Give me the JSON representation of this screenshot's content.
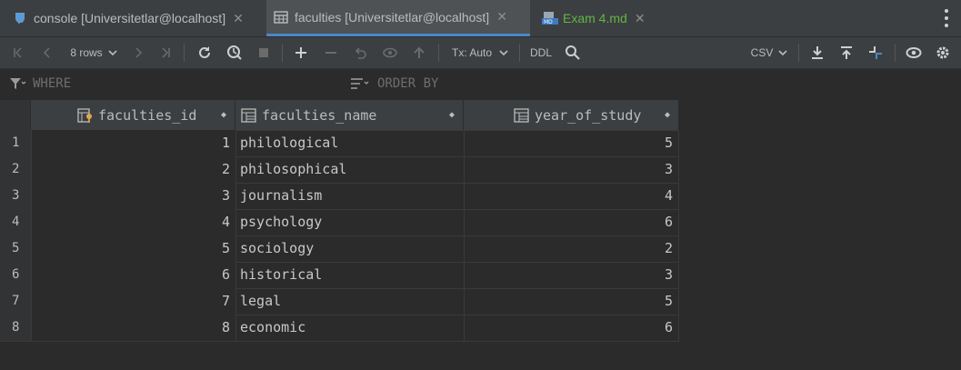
{
  "tabs": [
    {
      "label": "console [Universitetlar@localhost]",
      "icon": "database-console-icon"
    },
    {
      "label": "faculties [Universitetlar@localhost]",
      "icon": "table-icon"
    },
    {
      "label": "Exam 4.md",
      "icon": "markdown-file-icon"
    }
  ],
  "toolbar": {
    "rows_label": "8 rows",
    "tx_label": "Tx: Auto",
    "ddl_label": "DDL",
    "csv_label": "CSV"
  },
  "filter": {
    "where_label": "WHERE",
    "order_label": "ORDER BY"
  },
  "columns": [
    "faculties_id",
    "faculties_name",
    "year_of_study"
  ],
  "rows": [
    {
      "n": "1",
      "id": "1",
      "name": "philological",
      "year": "5"
    },
    {
      "n": "2",
      "id": "2",
      "name": "philosophical",
      "year": "3"
    },
    {
      "n": "3",
      "id": "3",
      "name": "journalism",
      "year": "4"
    },
    {
      "n": "4",
      "id": "4",
      "name": "psychology",
      "year": "6"
    },
    {
      "n": "5",
      "id": "5",
      "name": "sociology",
      "year": "2"
    },
    {
      "n": "6",
      "id": "6",
      "name": "historical",
      "year": "3"
    },
    {
      "n": "7",
      "id": "7",
      "name": "legal",
      "year": "5"
    },
    {
      "n": "8",
      "id": "8",
      "name": "economic",
      "year": "6"
    }
  ],
  "colors": {
    "accent": "#4a88c7",
    "md_tab": "#62b543",
    "background": "#2b2b2b"
  }
}
